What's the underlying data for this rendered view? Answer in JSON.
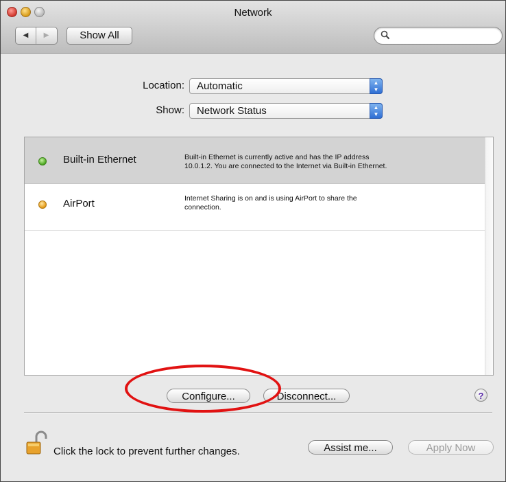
{
  "window": {
    "title": "Network"
  },
  "toolbar": {
    "back_glyph": "◀",
    "forward_glyph": "▶",
    "show_all_label": "Show All",
    "search_placeholder": "",
    "search_icon": "magnifier-icon"
  },
  "location": {
    "label": "Location:",
    "value": "Automatic"
  },
  "show": {
    "label": "Show:",
    "value": "Network Status"
  },
  "services": [
    {
      "name": "Built-in Ethernet",
      "status_color": "green",
      "description_line1": "Built-in Ethernet is currently active and has the IP address",
      "description_line2": "10.0.1.2. You are connected to the Internet via Built-in Ethernet.",
      "selected": true
    },
    {
      "name": "AirPort",
      "status_color": "amber",
      "description_line1": "Internet Sharing is on and is using AirPort to share the",
      "description_line2": "connection.",
      "selected": false
    }
  ],
  "actions": {
    "configure_label": "Configure...",
    "disconnect_label": "Disconnect...",
    "help_label": "?"
  },
  "footer": {
    "lock_text": "Click the lock to prevent further changes.",
    "assist_label": "Assist me...",
    "apply_label": "Apply Now",
    "lock_icon": "open-padlock-icon"
  },
  "colors": {
    "annotation": "#e11212",
    "popup_accent": "#2f6fd4"
  }
}
